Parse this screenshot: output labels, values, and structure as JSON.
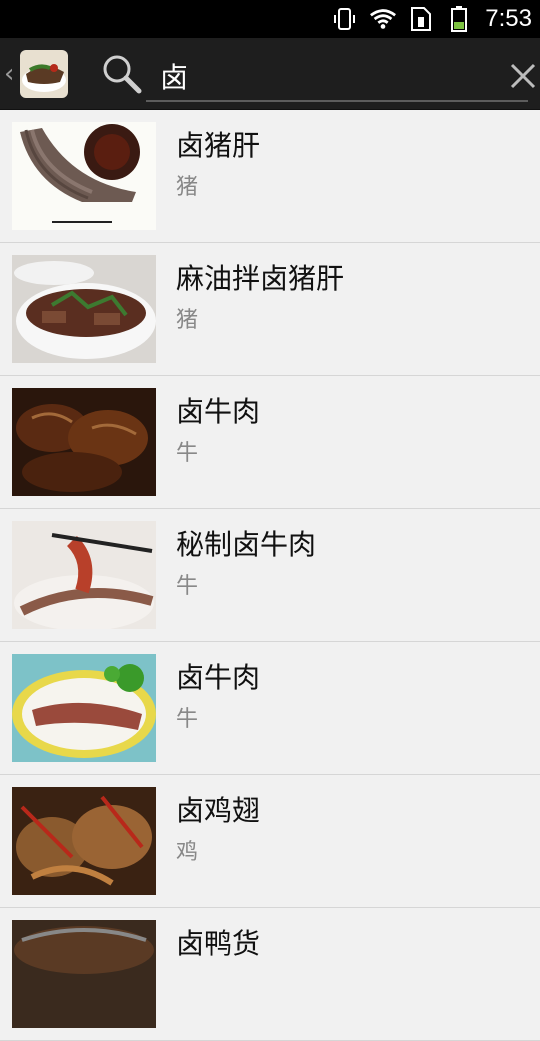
{
  "status": {
    "time": "7:53"
  },
  "search": {
    "query": "卤"
  },
  "items": [
    {
      "title": "卤猪肝",
      "category": "猪"
    },
    {
      "title": "麻油拌卤猪肝",
      "category": "猪"
    },
    {
      "title": "卤牛肉",
      "category": "牛"
    },
    {
      "title": "秘制卤牛肉",
      "category": "牛"
    },
    {
      "title": "卤牛肉",
      "category": "牛"
    },
    {
      "title": "卤鸡翅",
      "category": "鸡"
    },
    {
      "title": "卤鸭货",
      "category": ""
    }
  ],
  "icons": {
    "back": "chevron-left-icon",
    "search": "search-icon",
    "clear": "close-icon"
  },
  "colors": {
    "accent": "#5c5c5c",
    "battery": "#7dc242"
  }
}
